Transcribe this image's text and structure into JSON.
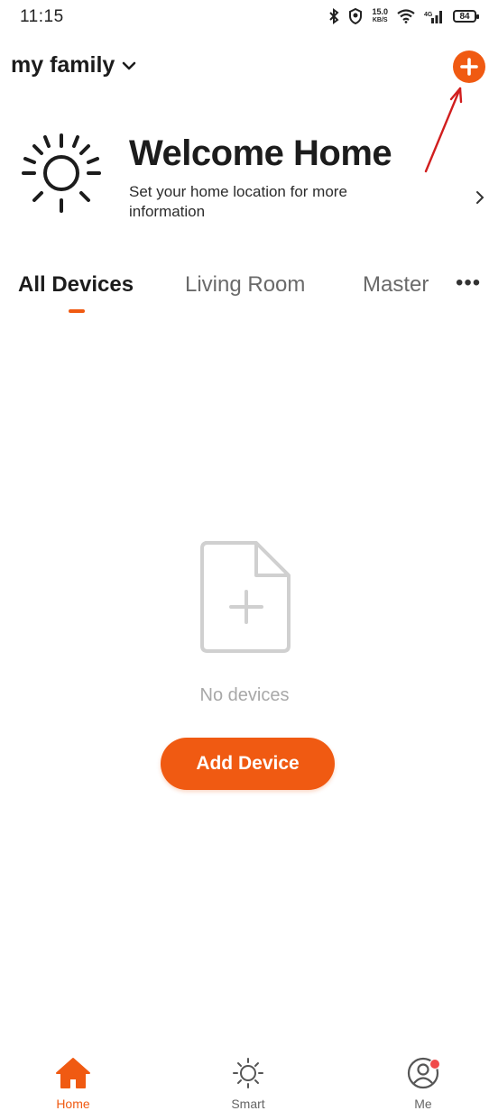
{
  "status_bar": {
    "time": "11:15",
    "net_speed_value": "15.0",
    "net_speed_unit": "KB/S",
    "battery": "84"
  },
  "header": {
    "family_label": "my family",
    "add_icon": "plus-circle-icon"
  },
  "welcome": {
    "title": "Welcome Home",
    "subtitle": "Set your home location for more information",
    "icon": "sun-icon"
  },
  "tabs": [
    {
      "label": "All Devices",
      "active": true
    },
    {
      "label": "Living Room",
      "active": false
    },
    {
      "label": "Master",
      "active": false
    }
  ],
  "tabs_more": "•••",
  "empty_state": {
    "icon": "document-plus-icon",
    "message": "No devices",
    "button_label": "Add Device"
  },
  "bottom_nav": [
    {
      "label": "Home",
      "icon": "house-icon",
      "active": true
    },
    {
      "label": "Smart",
      "icon": "sun-outline-icon",
      "active": false
    },
    {
      "label": "Me",
      "icon": "person-circle-icon",
      "active": false,
      "badge": true
    }
  ],
  "colors": {
    "accent": "#f05a12",
    "badge": "#f04a4a",
    "text_primary": "#1c1c1c",
    "text_muted": "#a8a8a8"
  }
}
